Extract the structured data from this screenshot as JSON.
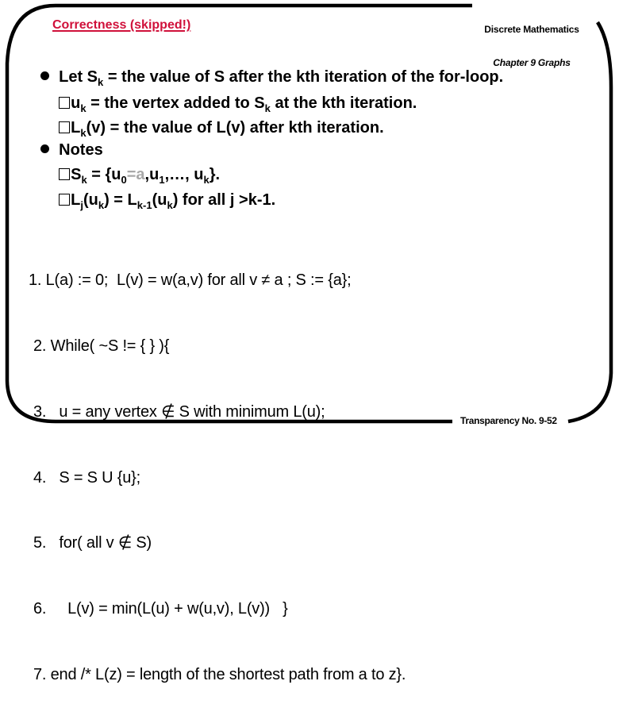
{
  "slide": {
    "title": "Correctness (skipped!)",
    "course_title": "Discrete Mathematics",
    "chapter": "Chapter 9 Graphs",
    "footer": "Transparency No. 9-52",
    "accent_color": "#d0103a"
  },
  "bullets": [
    {
      "parts": [
        "Let S",
        "k",
        " = the value of S after the kth iteration of the for-loop."
      ],
      "subitems": [
        {
          "parts": [
            "u",
            "k",
            " = the vertex added to S",
            "k",
            " at the kth iteration."
          ]
        },
        {
          "parts": [
            "L",
            "k",
            "(v) = the value of L(v) after kth iteration."
          ]
        }
      ]
    },
    {
      "parts": [
        "Notes"
      ],
      "subitems": [
        {
          "parts": [
            "S",
            "k",
            " = {u",
            "0",
            "=a",
            ",u",
            "1",
            ",…, u",
            "k",
            "}."
          ]
        },
        {
          "parts": [
            "L",
            "j",
            "(u",
            "k",
            ") = L",
            "k-1",
            "(u",
            "k",
            ") for all j >k-1."
          ]
        }
      ]
    }
  ],
  "algorithm": [
    "1. L(a) := 0;  L(v) = w(a,v) for all v ≠ a ; S := {a};",
    "2. While( ~S != { } ){",
    "3.   u = any vertex ∉ S with minimum L(u);",
    "4.   S = S U {u};",
    "5.   for( all v ∉ S)",
    "6.     L(v) = min(L(u) + w(u,v), L(v))   }",
    "7. end /* L(z) = length of the shortest path from a to z}."
  ]
}
